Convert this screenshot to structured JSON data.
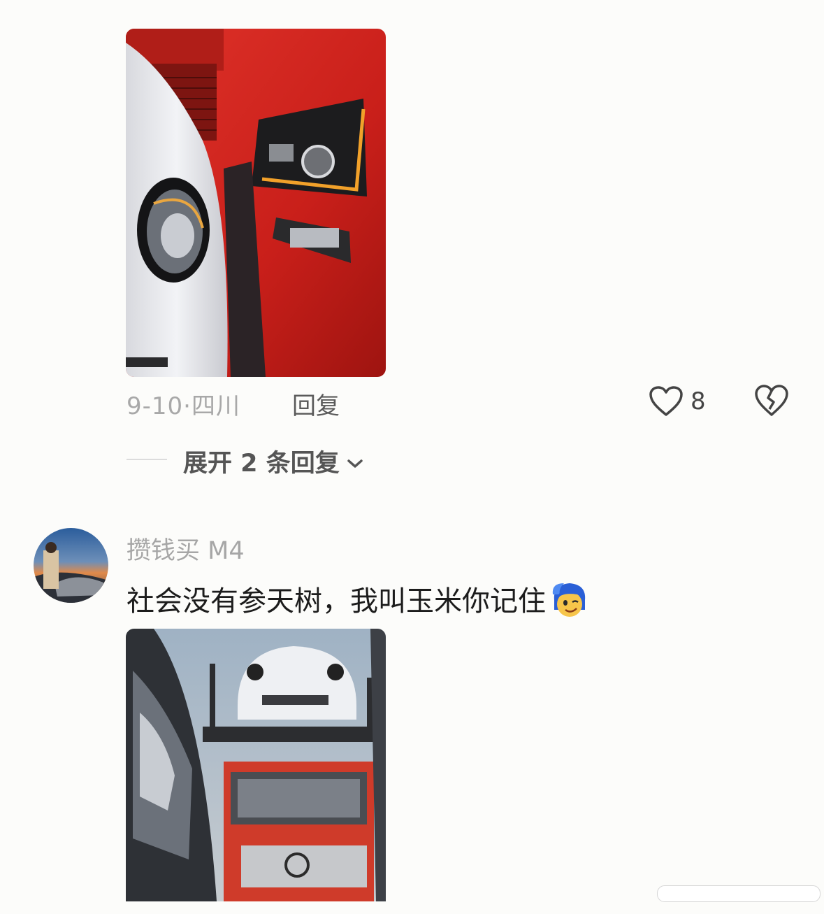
{
  "comment1": {
    "image_alt": "white car next to red truck",
    "date": "9-10",
    "separator": "·",
    "location": "四川",
    "reply_label": "回复",
    "like_count": "8",
    "expand_replies": "展开 2 条回复"
  },
  "comment2": {
    "username": "攒钱买 M4",
    "text": "社会没有参天树，我叫玉米你记住",
    "emoji": "smirk-blue-hair-emoji",
    "image_alt": "white car on top of red car carrier truck"
  },
  "icons": {
    "like": "heart-outline-icon",
    "dislike": "broken-heart-icon",
    "expand": "chevron-down-icon"
  }
}
